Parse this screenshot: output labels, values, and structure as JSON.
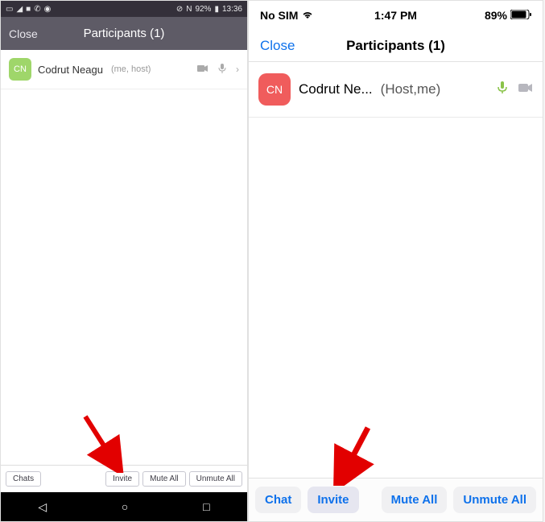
{
  "android": {
    "status": {
      "time": "13:36",
      "battery": "92%",
      "nfc": "N"
    },
    "header": {
      "close": "Close",
      "title": "Participants (1)"
    },
    "participant": {
      "initials": "CN",
      "name": "Codrut Neagu",
      "role": "(me, host)"
    },
    "toolbar": {
      "chats": "Chats",
      "invite": "Invite",
      "mute_all": "Mute All",
      "unmute_all": "Unmute All"
    }
  },
  "ios": {
    "status": {
      "carrier": "No SIM",
      "time": "1:47 PM",
      "battery": "89%"
    },
    "header": {
      "close": "Close",
      "title": "Participants (1)"
    },
    "participant": {
      "initials": "CN",
      "name": "Codrut Ne...",
      "role": "(Host,me)"
    },
    "toolbar": {
      "chat": "Chat",
      "invite": "Invite",
      "mute_all": "Mute All",
      "unmute_all": "Unmute All"
    }
  }
}
